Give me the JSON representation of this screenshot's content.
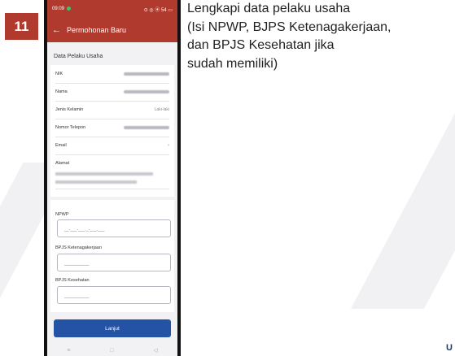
{
  "step": {
    "number": "11",
    "color": "#b03a2e"
  },
  "instruction": {
    "lines": [
      "Lengkapi data pelaku usaha",
      "(Isi NPWP, BJPS Ketenagakerjaan,",
      "dan BPJS Kesehatan jika",
      "sudah memiliki)"
    ]
  },
  "edge_letter": "U",
  "phone": {
    "status_bar": {
      "time": "09:09",
      "icons": "⊙ ◎ ⦿ 54 ▭"
    },
    "app_bar": {
      "back_icon": "arrow-left-icon",
      "title": "Permohonan Baru",
      "color": "#b03a2e"
    },
    "section_title": "Data Pelaku Usaha",
    "fields": [
      {
        "label": "NIK"
      },
      {
        "label": "Nama"
      },
      {
        "label": "Jenis Kelamin",
        "value": "Laki-laki"
      },
      {
        "label": "Nomor Telepon"
      },
      {
        "label": "Email"
      }
    ],
    "alamat_label": "Alamat",
    "inputs": [
      {
        "label": "NPWP",
        "placeholder": "__-___-___._-___.___"
      },
      {
        "label": "BPJS Ketenagakerjaan",
        "placeholder": "___________"
      },
      {
        "label": "BPJS Kesehatan",
        "placeholder": "___________"
      }
    ],
    "submit_button": {
      "label": "Lanjut",
      "color": "#2453a6"
    },
    "nav_icons": [
      "menu-icon",
      "home-icon",
      "back-icon"
    ]
  }
}
